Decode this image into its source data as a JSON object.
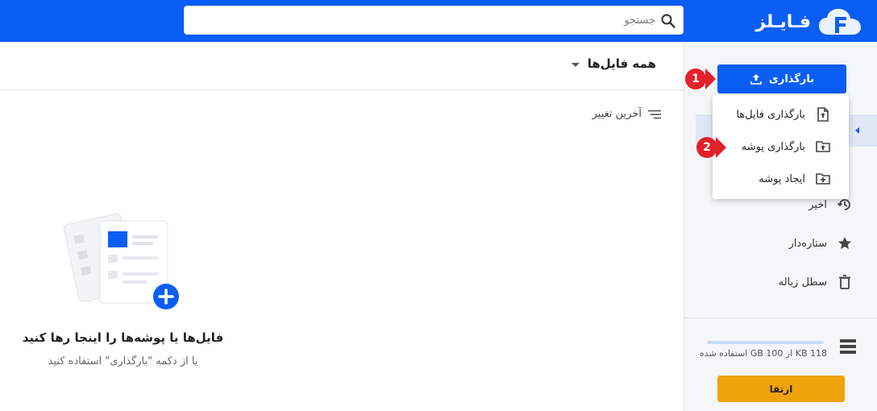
{
  "header": {
    "logo_text": "فـایـلز",
    "search_placeholder": "جستجو",
    "brand_color": "#0a5ef6"
  },
  "main": {
    "title": "همه فایل‌ها",
    "sort_label": "آخرین تغییر",
    "empty_title": "فایل‌ها یا پوشه‌ها را اینجا رها کنید",
    "empty_subtitle": "یا از دکمه \"بارگذاری\" استفاده کنید"
  },
  "sidebar": {
    "upload_label": "بارگذاری",
    "items": [
      {
        "label": "اخیر",
        "icon": "history-icon"
      },
      {
        "label": "ستاره‌دار",
        "icon": "star-icon"
      },
      {
        "label": "سطل زباله",
        "icon": "trash-icon"
      }
    ],
    "storage_text": "118 KB از 100 GB استفاده شده",
    "storage_used_fraction": 1e-06,
    "upgrade_label": "ارتقا",
    "upgrade_color": "#f0a30a"
  },
  "upload_menu": {
    "items": [
      {
        "label": "بارگذاری فایل‌ها",
        "icon": "file-upload-icon"
      },
      {
        "label": "بارگذاری پوشه",
        "icon": "folder-upload-icon"
      },
      {
        "label": "ایجاد پوشه",
        "icon": "folder-add-icon"
      }
    ]
  },
  "steps": {
    "one": "1",
    "two": "2",
    "color": "#e4202a"
  }
}
